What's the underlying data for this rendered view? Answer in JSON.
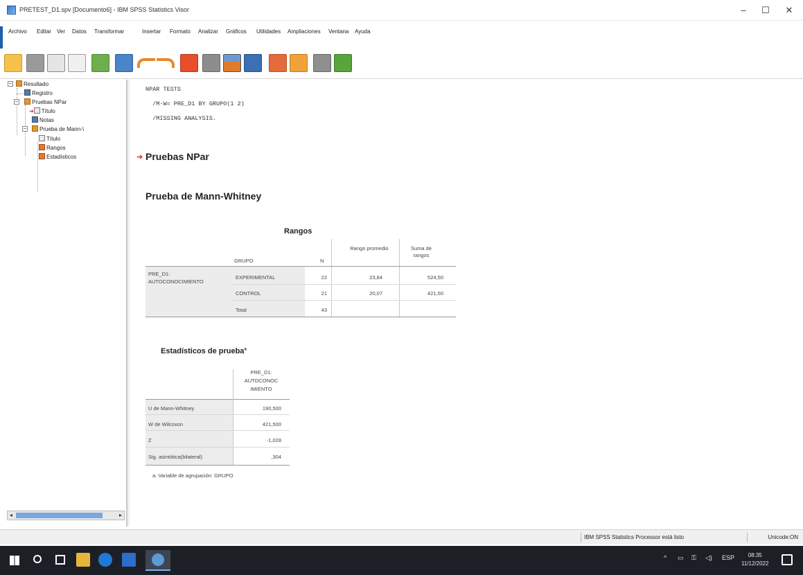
{
  "window": {
    "title": "PRETEST_D1.spv [Documento6] - IBM SPSS Statistics Visor",
    "controls": {
      "minimize": "–",
      "maximize": "☐",
      "close": "✕"
    }
  },
  "menu": [
    "Archivo",
    "Editar",
    "Ver",
    "Datos",
    "Transformar",
    "Insertar",
    "Formato",
    "Analizar",
    "Gráficos",
    "Utilidades",
    "Ampliaciones",
    "Ventana",
    "Ayuda"
  ],
  "toolbar_icons": [
    "open-icon",
    "save-icon",
    "print-icon",
    "print-preview-icon",
    "export-icon",
    "recall-dialog-icon",
    "undo-icon",
    "redo-icon",
    "goto-data-icon",
    "goto-case-icon",
    "goto-variable-icon",
    "variables-icon",
    "insert-output-icon",
    "designate-window-icon",
    "select-icon",
    "show-icon"
  ],
  "outline": {
    "items": [
      {
        "label": "Resultado",
        "icon": "output-book-icon"
      },
      {
        "label": "Registro",
        "icon": "log-icon"
      },
      {
        "label": "Pruebas NPar",
        "icon": "procedure-book-icon"
      },
      {
        "label": "Título",
        "icon": "title-icon"
      },
      {
        "label": "Notas",
        "icon": "notes-icon"
      },
      {
        "label": "Prueba de Mann-\\",
        "icon": "procedure-book-icon"
      },
      {
        "label": "Título",
        "icon": "title-icon"
      },
      {
        "label": "Rangos",
        "icon": "table-icon"
      },
      {
        "label": "Estadísticos",
        "icon": "table-icon"
      }
    ]
  },
  "syntax": {
    "line1": "NPAR TESTS",
    "line2": "  /M-W= PRE_D1 BY GRUPO(1 2)",
    "line3": "  /MISSING ANALYSIS."
  },
  "output": {
    "heading": "Pruebas NPar",
    "subheading": "Prueba de Mann-Whitney",
    "ranks": {
      "title": "Rangos",
      "headers": {
        "grupo": "GRUPO",
        "n": "N",
        "mean_rank": "Rango promedio",
        "sum_ranks": "Suma de rangos"
      },
      "variable_line1": "PRE_D1:",
      "variable_line2": "AUTOCONOCIMIENTO",
      "rows": [
        {
          "group": "EXPERIMENTAL",
          "n": "22",
          "mean_rank": "23,84",
          "sum_ranks": "524,50"
        },
        {
          "group": "CONTROL",
          "n": "21",
          "mean_rank": "20,07",
          "sum_ranks": "421,50"
        },
        {
          "group": "Total",
          "n": "43",
          "mean_rank": "",
          "sum_ranks": ""
        }
      ]
    },
    "test_stats": {
      "title": "Estadísticos de prueba",
      "title_sup": "a",
      "column_header_line1": "PRE_D1:",
      "column_header_line2": "AUTOCONOC",
      "column_header_line3": "IMIENTO",
      "rows": [
        {
          "label": "U de Mann-Whitney",
          "value": "190,500"
        },
        {
          "label": "W de Wilcoxon",
          "value": "421,500"
        },
        {
          "label": "Z",
          "value": "-1,028"
        },
        {
          "label": "Sig. asintótica(bilateral)",
          "value": ",304"
        }
      ],
      "footnote": "a. Variable de agrupación: GRUPO"
    }
  },
  "statusbar": {
    "processor": "IBM SPSS Statistics Processor está listo",
    "unicode": "Unicode:ON"
  },
  "taskbar": {
    "language": "ESP",
    "time": "08:35",
    "date": "11/12/2022"
  }
}
